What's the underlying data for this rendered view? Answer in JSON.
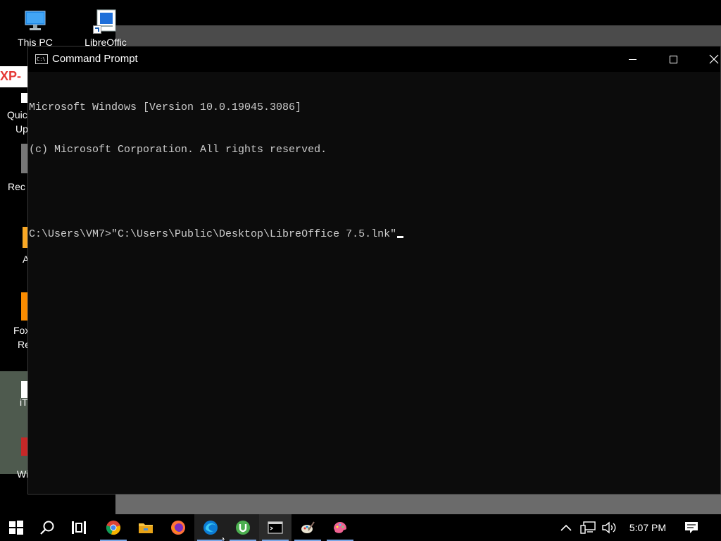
{
  "desktop": {
    "icons": [
      {
        "name": "This PC"
      },
      {
        "name": "LibreOffic"
      }
    ],
    "fragments": [
      "XP-",
      "Quic",
      "Up",
      "Rec",
      "A",
      "Fox",
      "Re",
      "iT",
      "Wi"
    ]
  },
  "cmd": {
    "title": "Command Prompt",
    "icon_text": "C:\\",
    "lines": [
      "Microsoft Windows [Version 10.0.19045.3086]",
      "(c) Microsoft Corporation. All rights reserved.",
      "",
      "C:\\Users\\VM7>\"C:\\Users\\Public\\Desktop\\LibreOffice 7.5.lnk\""
    ]
  },
  "taskbar": {
    "items": [
      "start-icon",
      "search-icon",
      "task-view-icon",
      "chrome-icon",
      "file-explorer-icon",
      "firefox-icon",
      "edge-icon",
      "utorrent-icon",
      "command-prompt-icon",
      "paint-icon",
      "paint3d-icon"
    ],
    "clock": "5:07 PM"
  }
}
